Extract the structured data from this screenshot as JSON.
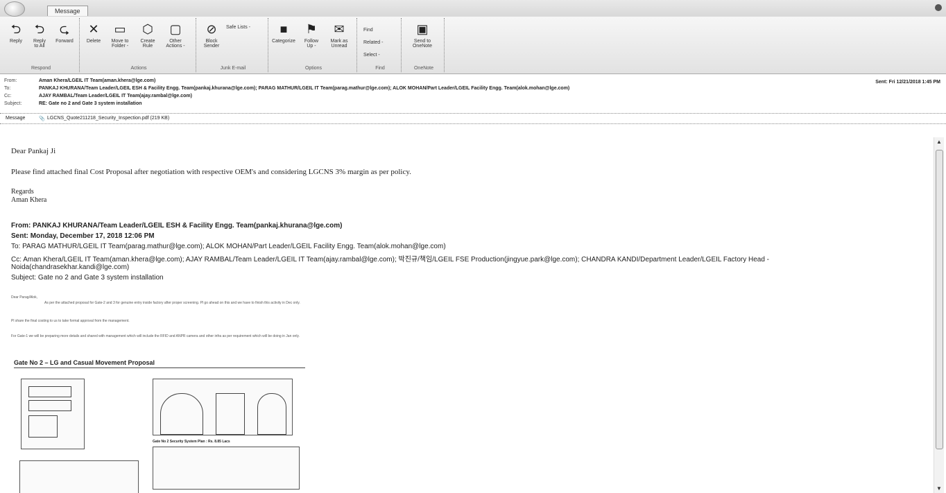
{
  "window": {
    "tab_label": "Message"
  },
  "ribbon": {
    "groups": {
      "respond": "Respond",
      "actions": "Actions",
      "junk": "Junk E-mail",
      "options": "Options",
      "find": "Find",
      "onenote": "OneNote"
    },
    "buttons": {
      "reply": "Reply",
      "reply_all_1": "Reply",
      "reply_all_2": "to All",
      "forward": "Forward",
      "delete": "Delete",
      "move_1": "Move to",
      "move_2": "Folder -",
      "create_rule_1": "Create",
      "create_rule_2": "Rule",
      "other_1": "Other",
      "other_2": "Actions -",
      "block_1": "Block",
      "block_2": "Sender",
      "safe_lists": "Safe Lists -",
      "categorize": "Categorize",
      "follow_1": "Follow",
      "follow_2": "Up -",
      "mark_1": "Mark as",
      "mark_2": "Unread",
      "find": "Find",
      "related": "Related -",
      "select": "Select -",
      "send_onenote_1": "Send to",
      "send_onenote_2": "OneNote"
    }
  },
  "header": {
    "from_label": "From:",
    "from": "Aman Khera/LGEIL IT Team(aman.khera@lge.com)",
    "to_label": "To:",
    "to": "PANKAJ KHURANA/Team Leader/LGEIL ESH & Facility Engg. Team(pankaj.khurana@lge.com); PARAG MATHUR/LGEIL IT Team(parag.mathur@lge.com); ALOK MOHAN/Part Leader/LGEIL Facility Engg. Team(alok.mohan@lge.com)",
    "cc_label": "Cc:",
    "cc": "AJAY RAMBAL/Team Leader/LGEIL IT Team(ajay.rambal@lge.com)",
    "subject_label": "Subject:",
    "subject": "RE: Gate no 2 and Gate 3 system installation",
    "sent_label": "Sent:",
    "sent": "Fri 12/21/2018 1:45 PM",
    "message_tab": "Message",
    "attachment": "LGCNS_Quote211218_Security_Inspection.pdf (219 KB)"
  },
  "body": {
    "greeting": "Dear Pankaj Ji",
    "line1": "Please find attached final Cost Proposal after negotiation with respective OEM's and considering LGCNS 3% margin as per policy.",
    "regards": "Regards",
    "signature": "Aman Khera",
    "fwd_from": "From: PANKAJ KHURANA/Team Leader/LGEIL ESH & Facility Engg. Team(pankaj.khurana@lge.com)",
    "fwd_sent": "Sent: Monday, December 17, 2018 12:06 PM",
    "fwd_to": "To: PARAG MATHUR/LGEIL IT Team(parag.mathur@lge.com); ALOK MOHAN/Part Leader/LGEIL Facility Engg. Team(alok.mohan@lge.com)",
    "fwd_cc": "Cc: Aman Khera/LGEIL IT Team(aman.khera@lge.com); AJAY RAMBAL/Team Leader/LGEIL IT Team(ajay.rambal@lge.com); 박진규/책임/LGEIL FSE Production(jingyue.park@lge.com); CHANDRA KANDI/Department Leader/LGEIL Factory Head -",
    "fwd_cc2": "Noida(chandrasekhar.kandi@lge.com)",
    "fwd_subject": "Subject: Gate no 2 and Gate 3 system installation",
    "small1": "Dear Parag/Alok,",
    "small2": "As per the attached proposal for Gate-2 and 3 for genuine entry inside factory after proper screening. Pl go ahead on this and we have to finish this activity in Dec only.",
    "small3": "Pl share the final costing to us to take formal approval from the management.",
    "small4": "For Gate-1 we will be preparing more details and shared with management which will include the RFID and ANPR camera and other infra as per requirement which will be doing in Jan only.",
    "gate_heading": "Gate No 2 – LG and Casual Movement Proposal",
    "fig_caption": "Gate No 2 Security System Plan : Rs. 8.85 Lacs"
  }
}
